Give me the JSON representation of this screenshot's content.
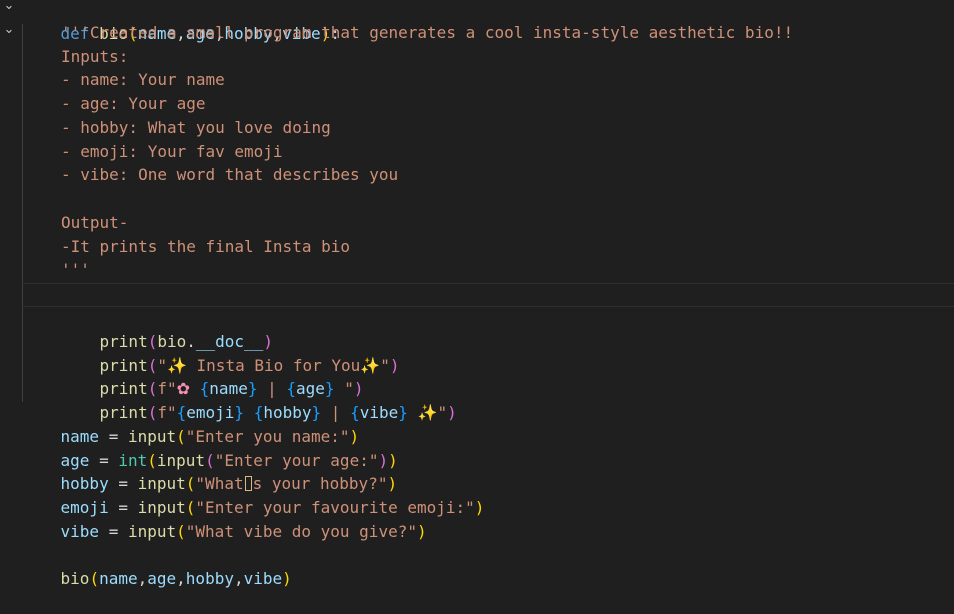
{
  "editor": {
    "fold_markers": [
      "⌄",
      "⌄"
    ],
    "lines": {
      "def_kw": "def",
      "def_name": "bio",
      "def_params": [
        "name",
        "age",
        "hobby",
        "vibe"
      ],
      "doc1": "'''Created a small program that generates a cool insta-style aesthetic bio!!",
      "doc2": "Inputs:",
      "doc3": "- name: Your name",
      "doc4": "- age: Your age",
      "doc5": "- hobby: What you love doing",
      "doc6": "- emoji: Your fav emoji",
      "doc7": "- vibe: One word that describes you",
      "doc8": "",
      "doc9": "Output-",
      "doc10": "-It prints the final Insta bio",
      "doc11": "'''",
      "print_doc": {
        "fn": "print",
        "obj": "bio",
        "attr": "__doc__"
      },
      "print_title": {
        "fn": "print",
        "text": " Insta Bio for You",
        "open_quote": "\"",
        "close_quote": "\""
      },
      "print_name_age": {
        "fn": "print",
        "prefix": "f\"",
        "v1": "name",
        "sep": " | ",
        "v2": "age",
        "suffix": " \""
      },
      "print_emoji_hobby_vibe": {
        "fn": "print",
        "prefix": "f\"",
        "v1": "emoji",
        "v2": "hobby",
        "sep": " | ",
        "v3": "vibe",
        "suffix": "\""
      },
      "assign_name": {
        "var": "name",
        "fn": "input",
        "arg": "\"Enter you name:\""
      },
      "assign_age": {
        "var": "age",
        "wrap": "int",
        "fn": "input",
        "arg": "\"Enter your age:\""
      },
      "assign_hobby": {
        "var": "hobby",
        "fn": "input",
        "arg_before": "\"What",
        "arg_after": "s your hobby?\""
      },
      "assign_emoji": {
        "var": "emoji",
        "fn": "input",
        "arg": "\"Enter your favourite emoji:\""
      },
      "assign_vibe": {
        "var": "vibe",
        "fn": "input",
        "arg": "\"What vibe do you give?\""
      },
      "call": {
        "fn": "bio",
        "args": [
          "name",
          "age",
          "hobby",
          "vibe"
        ]
      }
    },
    "emoji_glyphs": {
      "sparkles": "✨",
      "flower": "✿"
    },
    "colors": {
      "background": "#1f1f1f",
      "keyword": "#569cd6",
      "function": "#dcdcaa",
      "variable": "#9cdcfe",
      "string": "#ce9178",
      "builtin": "#4ec9b0",
      "bracket_gold": "#ffd700",
      "bracket_purple": "#da70d6",
      "bracket_blue": "#179fff"
    }
  }
}
